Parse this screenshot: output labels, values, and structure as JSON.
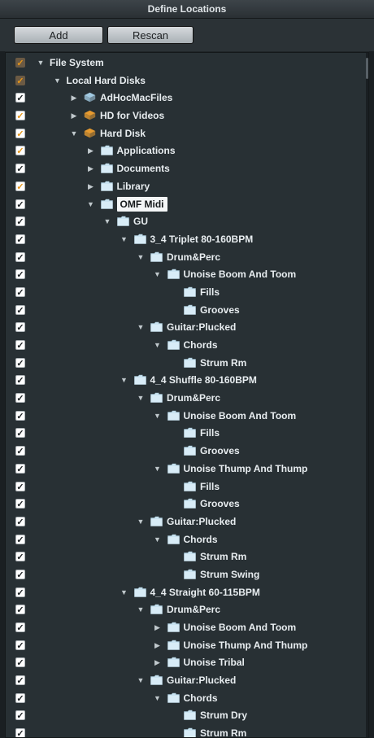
{
  "window": {
    "title": "Define Locations"
  },
  "toolbar": {
    "add_label": "Add",
    "rescan_label": "Rescan"
  },
  "colors": {
    "folder": "#c9e3f1",
    "hard_disk": "#f0a030",
    "network_disk": "#a9d3ec",
    "check_orange": "#e69619"
  },
  "tree": [
    {
      "label": "File System",
      "level": 0,
      "expand": "open",
      "icon": "none",
      "check": "orangedim"
    },
    {
      "label": "Local Hard Disks",
      "level": 1,
      "expand": "open",
      "icon": "none",
      "check": "orangedim"
    },
    {
      "label": "AdHocMacFiles",
      "level": 2,
      "expand": "closed",
      "icon": "disk-blue",
      "check": "white"
    },
    {
      "label": "HD for Videos",
      "level": 2,
      "expand": "closed",
      "icon": "disk-orange",
      "check": "orange"
    },
    {
      "label": "Hard Disk",
      "level": 2,
      "expand": "open",
      "icon": "disk-orange",
      "check": "orange"
    },
    {
      "label": "Applications",
      "level": 3,
      "expand": "closed",
      "icon": "folder",
      "check": "orange"
    },
    {
      "label": "Documents",
      "level": 3,
      "expand": "closed",
      "icon": "folder",
      "check": "white"
    },
    {
      "label": "Library",
      "level": 3,
      "expand": "closed",
      "icon": "folder",
      "check": "orange"
    },
    {
      "label": "OMF Midi",
      "level": 3,
      "expand": "open",
      "icon": "folder",
      "check": "white",
      "selected": true
    },
    {
      "label": "GU",
      "level": 4,
      "expand": "open",
      "icon": "folder",
      "check": "white"
    },
    {
      "label": "3_4 Triplet 80-160BPM",
      "level": 5,
      "expand": "open",
      "icon": "folder",
      "check": "white"
    },
    {
      "label": "Drum&Perc",
      "level": 6,
      "expand": "open",
      "icon": "folder",
      "check": "white"
    },
    {
      "label": "Unoise Boom And Toom",
      "level": 7,
      "expand": "open",
      "icon": "folder",
      "check": "white"
    },
    {
      "label": "Fills",
      "level": 8,
      "expand": "none",
      "icon": "folder",
      "check": "white"
    },
    {
      "label": "Grooves",
      "level": 8,
      "expand": "none",
      "icon": "folder",
      "check": "white"
    },
    {
      "label": "Guitar:Plucked",
      "level": 6,
      "expand": "open",
      "icon": "folder",
      "check": "white"
    },
    {
      "label": "Chords",
      "level": 7,
      "expand": "open",
      "icon": "folder",
      "check": "white"
    },
    {
      "label": "Strum Rm",
      "level": 8,
      "expand": "none",
      "icon": "folder",
      "check": "white"
    },
    {
      "label": "4_4 Shuffle 80-160BPM",
      "level": 5,
      "expand": "open",
      "icon": "folder",
      "check": "white"
    },
    {
      "label": "Drum&Perc",
      "level": 6,
      "expand": "open",
      "icon": "folder",
      "check": "white"
    },
    {
      "label": "Unoise Boom And Toom",
      "level": 7,
      "expand": "open",
      "icon": "folder",
      "check": "white"
    },
    {
      "label": "Fills",
      "level": 8,
      "expand": "none",
      "icon": "folder",
      "check": "white"
    },
    {
      "label": "Grooves",
      "level": 8,
      "expand": "none",
      "icon": "folder",
      "check": "white"
    },
    {
      "label": "Unoise Thump And Thump",
      "level": 7,
      "expand": "open",
      "icon": "folder",
      "check": "white"
    },
    {
      "label": "Fills",
      "level": 8,
      "expand": "none",
      "icon": "folder",
      "check": "white"
    },
    {
      "label": "Grooves",
      "level": 8,
      "expand": "none",
      "icon": "folder",
      "check": "white"
    },
    {
      "label": "Guitar:Plucked",
      "level": 6,
      "expand": "open",
      "icon": "folder",
      "check": "white"
    },
    {
      "label": "Chords",
      "level": 7,
      "expand": "open",
      "icon": "folder",
      "check": "white"
    },
    {
      "label": "Strum Rm",
      "level": 8,
      "expand": "none",
      "icon": "folder",
      "check": "white"
    },
    {
      "label": "Strum Swing",
      "level": 8,
      "expand": "none",
      "icon": "folder",
      "check": "white"
    },
    {
      "label": "4_4 Straight 60-115BPM",
      "level": 5,
      "expand": "open",
      "icon": "folder",
      "check": "white"
    },
    {
      "label": "Drum&Perc",
      "level": 6,
      "expand": "open",
      "icon": "folder",
      "check": "white"
    },
    {
      "label": "Unoise Boom And Toom",
      "level": 7,
      "expand": "closed",
      "icon": "folder",
      "check": "white"
    },
    {
      "label": "Unoise Thump And Thump",
      "level": 7,
      "expand": "closed",
      "icon": "folder",
      "check": "white"
    },
    {
      "label": "Unoise Tribal",
      "level": 7,
      "expand": "closed",
      "icon": "folder",
      "check": "white"
    },
    {
      "label": "Guitar:Plucked",
      "level": 6,
      "expand": "open",
      "icon": "folder",
      "check": "white"
    },
    {
      "label": "Chords",
      "level": 7,
      "expand": "open",
      "icon": "folder",
      "check": "white"
    },
    {
      "label": "Strum Dry",
      "level": 8,
      "expand": "none",
      "icon": "folder",
      "check": "white"
    },
    {
      "label": "Strum Rm",
      "level": 8,
      "expand": "none",
      "icon": "folder",
      "check": "white"
    }
  ]
}
